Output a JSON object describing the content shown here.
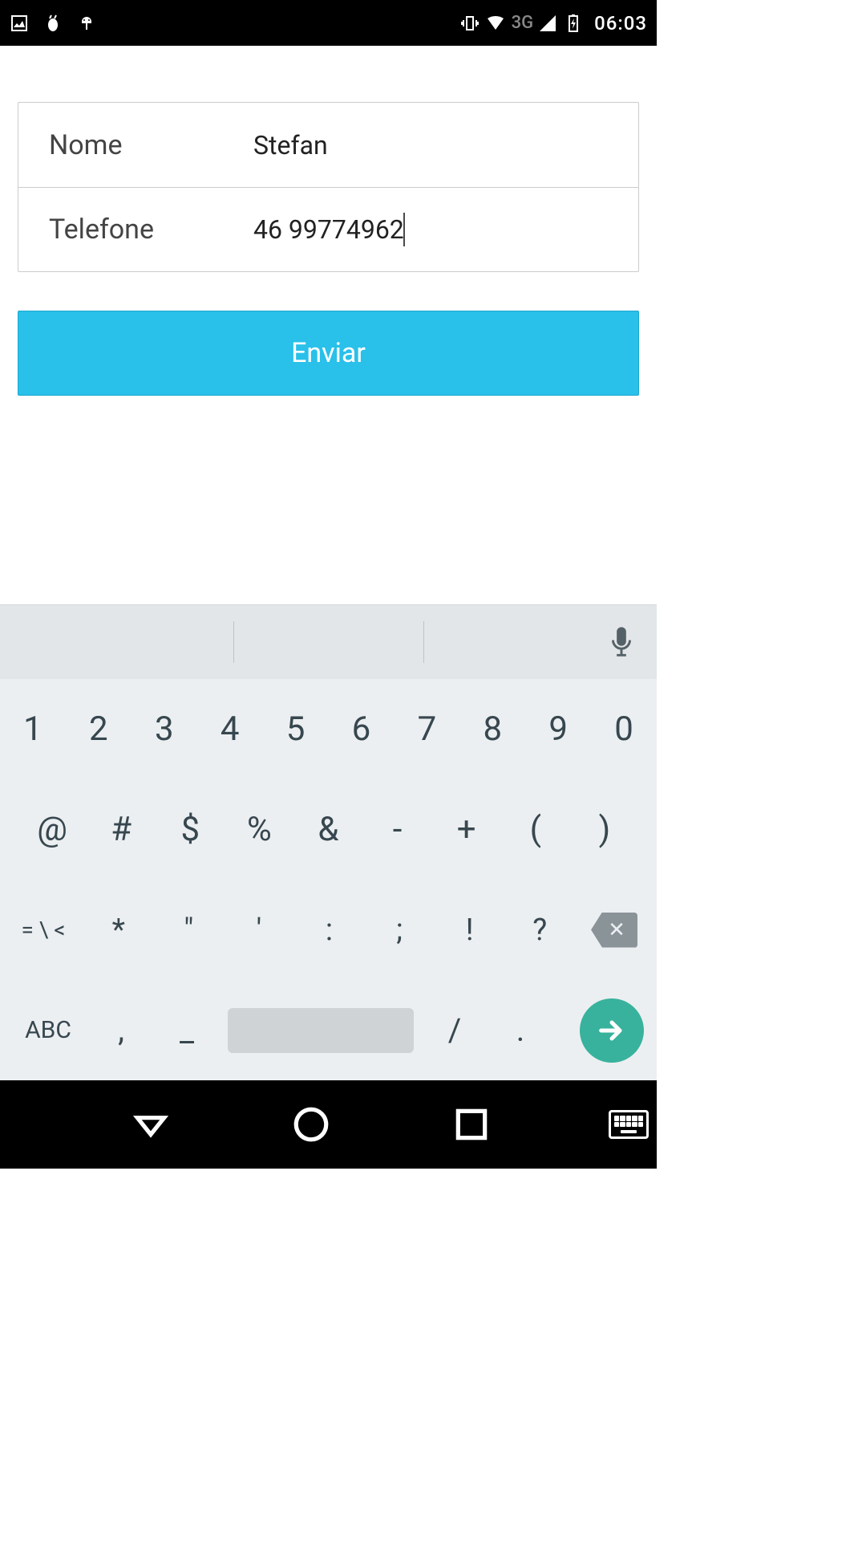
{
  "status": {
    "network_label": "3G",
    "time": "06:03"
  },
  "form": {
    "name_label": "Nome",
    "name_value": "Stefan",
    "phone_label": "Telefone",
    "phone_value": "46 99774962",
    "submit_label": "Enviar"
  },
  "keyboard": {
    "row1": [
      "1",
      "2",
      "3",
      "4",
      "5",
      "6",
      "7",
      "8",
      "9",
      "0"
    ],
    "row2": [
      "@",
      "#",
      "$",
      "%",
      "&",
      "-",
      "+",
      "(",
      ")"
    ],
    "row3_alt": "= \\ <",
    "row3": [
      "*",
      "\"",
      "'",
      ":",
      ";",
      "!",
      "?"
    ],
    "row4_abc": "ABC",
    "row4": [
      ",",
      "_"
    ],
    "row4b": [
      "/",
      "."
    ]
  }
}
